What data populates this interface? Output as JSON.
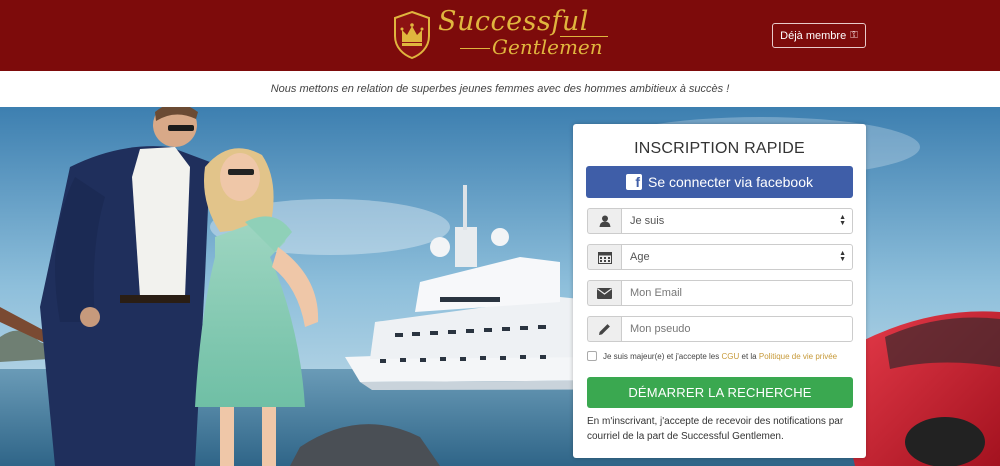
{
  "header": {
    "logo_line1": "Successful",
    "logo_line2": "Gentlemen",
    "member_label": "Déjà membre",
    "colors": {
      "background": "#7d0b0b",
      "logo_gold": "#e0b53e"
    },
    "icons": {
      "logo": "crown-shield-icon",
      "member": "key-icon"
    }
  },
  "tagline": "Nous mettons en relation de superbes jeunes femmes avec des hommes ambitieux à succès !",
  "form": {
    "title": "INSCRIPTION RAPIDE",
    "facebook_label": "Se connecter via facebook",
    "gender_select": {
      "value": "Je suis",
      "icon": "user-icon"
    },
    "age_select": {
      "value": "Age",
      "icon": "calendar-icon"
    },
    "email": {
      "placeholder": "Mon Email",
      "icon": "envelope-icon"
    },
    "pseudo": {
      "placeholder": "Mon pseudo",
      "icon": "pencil-icon"
    },
    "agree_prefix": "Je suis majeur(e) et j'accepte les",
    "agree_cgu": "CGU",
    "agree_mid": "et la",
    "agree_privacy": "Politique de vie privée",
    "submit_label": "DÉMARRER LA RECHERCHE",
    "notice": "En m'inscrivant, j'accepte de recevoir des notifications par courriel de la part de Successful Gentlemen.",
    "colors": {
      "facebook": "#3f5ea8",
      "submit": "#3aa850",
      "link": "#c79a3a"
    }
  }
}
